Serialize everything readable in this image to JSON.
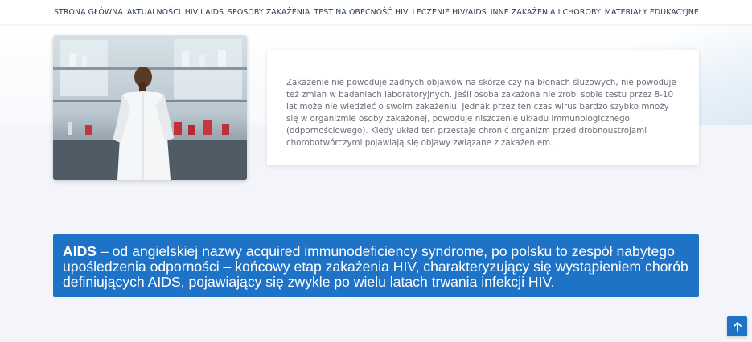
{
  "nav": {
    "items": [
      {
        "label": "STRONA GŁÓWNA"
      },
      {
        "label": "AKTUALNOŚCI"
      },
      {
        "label": "HIV I AIDS"
      },
      {
        "label": "SPOSOBY ZAKAŻENIA"
      },
      {
        "label": "TEST NA OBECNOŚĆ HIV"
      },
      {
        "label": "LECZENIE HIV/AIDS"
      },
      {
        "label": "INNE ZAKAŻENIA I CHOROBY"
      },
      {
        "label": "MATERIAŁY EDUKACYJNE"
      }
    ]
  },
  "content": {
    "paragraph": "Zakażenie nie powoduje żadnych objawów na skórze czy na błonach śluzowych, nie powoduje też zmian w badaniach laboratoryjnych. Jeśli osoba zakażona nie zrobi sobie testu przez 8-10 lat może nie wiedzieć o swoim zakażeniu. Jednak przez ten czas wirus bardzo szybko mnoży się w organizmie osoby zakażonej, powoduje niszczenie układu immunologicznego (odpornościowego). Kiedy układ ten przestaje chronić organizm przed drobnoustrojami chorobotwórczymi pojawiają się objawy związane z zakażeniem."
  },
  "aids_definition": {
    "term": "AIDS",
    "definition": " – od angielskiej nazwy acquired immunodeficiency syndrome, po polsku to zespół nabytego upośledzenia odporności – końcowy etap zakażenia HIV, charakteryzujący się wystąpieniem chorób definiujących AIDS, pojawiający się zwykle po wielu latach trwania infekcji HIV."
  },
  "icons": {
    "scroll_top": "arrow-up-icon"
  },
  "colors": {
    "accent": "#1f73c7",
    "nav_text": "#2a3a55",
    "body_text": "#6a6f78"
  }
}
